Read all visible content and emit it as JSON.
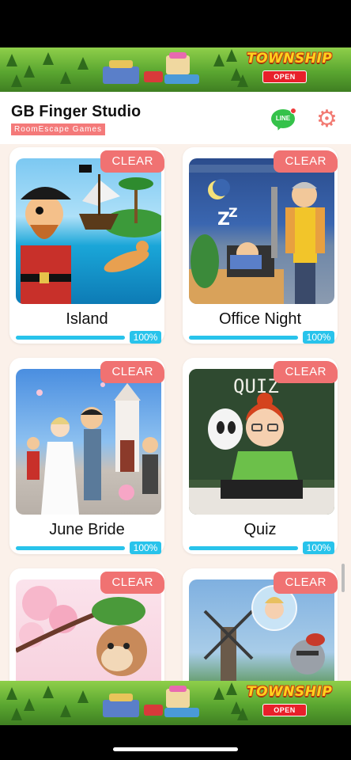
{
  "ads": {
    "brand": "TOWNSHIP",
    "open_label": "OPEN"
  },
  "header": {
    "title": "GB Finger Studio",
    "subtitle": "RoomEscape  Games",
    "line_label": "LINE"
  },
  "games": [
    {
      "title": "Island",
      "status": "CLEAR",
      "progress": 1.0,
      "progress_label": "100%"
    },
    {
      "title": "Office Night",
      "status": "CLEAR",
      "progress": 1.0,
      "progress_label": "100%"
    },
    {
      "title": "June Bride",
      "status": "CLEAR",
      "progress": 1.0,
      "progress_label": "100%"
    },
    {
      "title": "Quiz",
      "status": "CLEAR",
      "progress": 1.0,
      "progress_label": "100%"
    },
    {
      "status": "CLEAR"
    },
    {
      "status": "CLEAR"
    }
  ],
  "quiz_board_text": "QUIZ",
  "colors": {
    "clear_badge": "#f07272",
    "progress": "#28c3eb",
    "background": "#fbf1ea",
    "accent": "#f27a72"
  },
  "icons": {
    "line": "line-chat-icon",
    "settings": "gear-icon"
  }
}
